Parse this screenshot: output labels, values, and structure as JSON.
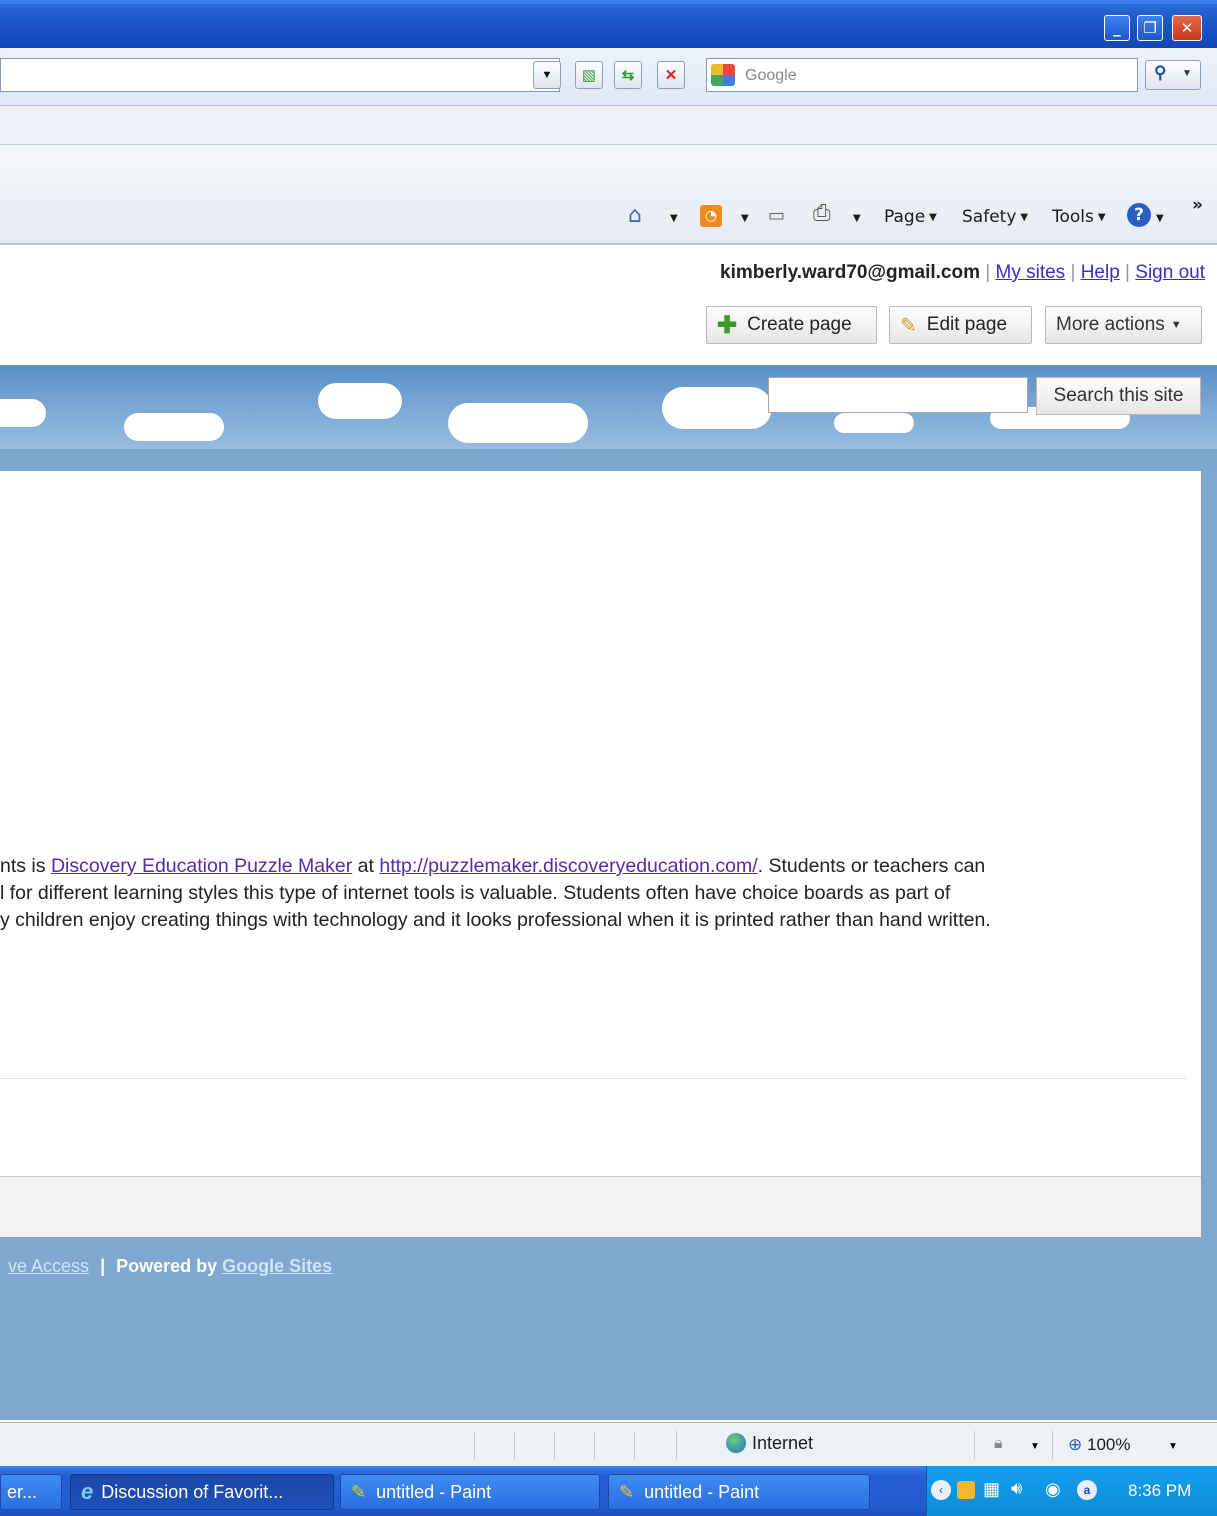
{
  "search": {
    "placeholder": "Google"
  },
  "command_bar": {
    "page": "Page",
    "safety": "Safety",
    "tools": "Tools",
    "chevron": "»"
  },
  "user_bar": {
    "email": "kimberly.ward70@gmail.com",
    "my_sites": "My sites",
    "help": "Help",
    "sign_out": "Sign out",
    "separator": "|"
  },
  "actions": {
    "create_page": "Create page",
    "edit_page": "Edit page",
    "more_actions": "More actions"
  },
  "site_search": {
    "button": "Search this site"
  },
  "content": {
    "line1_prefix": "nts is ",
    "link1": "Discovery Education Puzzle Maker",
    "line1_mid": " at ",
    "link2": "http://puzzlemaker.discoveryeducation.com/",
    "line1_suffix": ". Students or teachers can",
    "line2": "l for different learning styles this type of internet tools is valuable. Students often have choice boards as part of",
    "line3": "y children enjoy creating things with technology and it looks professional when it is printed rather than hand written."
  },
  "footer": {
    "access_link": "ve Access",
    "separator": "|",
    "powered_by": "Powered by",
    "google_sites": "Google Sites"
  },
  "statusbar": {
    "zone": "Internet",
    "zoom": "100%"
  },
  "taskbar": {
    "items": [
      "er...",
      "Discussion of Favorit...",
      "untitled - Paint",
      "untitled - Paint"
    ],
    "clock": "8:36 PM"
  },
  "colors": {
    "titlebar": "#1d56c8",
    "link": "#3b2dc8",
    "visited_link": "#5a2ba8",
    "page_bg": "#7fa7cf",
    "taskbar": "#245cd0"
  }
}
